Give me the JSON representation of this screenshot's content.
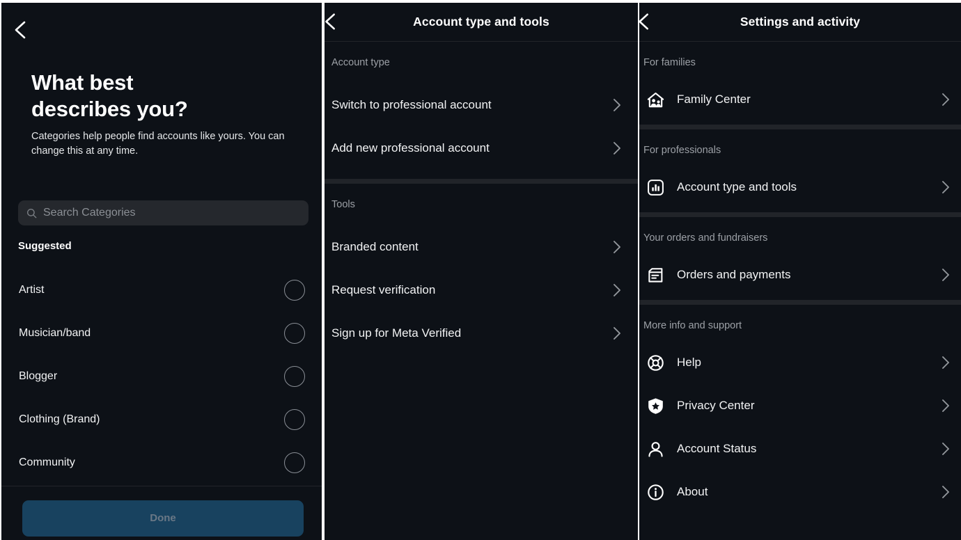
{
  "theme": {
    "background": "#0d1117",
    "page_background": "#ffffff",
    "text_primary": "#f2f3f4",
    "text_secondary": "#9ca0a6",
    "divider": "#212429",
    "search_field_bg": "#25282d",
    "done_button_bg": "#18425f",
    "done_button_text": "#6a7886"
  },
  "panel1": {
    "back_icon": "chevron-left-icon",
    "heading_line1": "What best",
    "heading_line2": "describes you?",
    "subtitle": "Categories help people find accounts like yours. You can change this at any time.",
    "search": {
      "icon": "search-icon",
      "placeholder": "Search Categories",
      "value": ""
    },
    "suggested_label": "Suggested",
    "categories": [
      {
        "label": "Artist",
        "selected": false
      },
      {
        "label": "Musician/band",
        "selected": false
      },
      {
        "label": "Blogger",
        "selected": false
      },
      {
        "label": "Clothing (Brand)",
        "selected": false
      },
      {
        "label": "Community",
        "selected": false
      }
    ],
    "done_label": "Done",
    "done_enabled": false
  },
  "panel2": {
    "back_icon": "chevron-left-icon",
    "title": "Account type and tools",
    "sections": [
      {
        "label": "Account type",
        "items": [
          {
            "label": "Switch to professional account",
            "chevron": "chevron-right-icon"
          },
          {
            "label": "Add new professional account",
            "chevron": "chevron-right-icon"
          }
        ]
      },
      {
        "label": "Tools",
        "items": [
          {
            "label": "Branded content",
            "chevron": "chevron-right-icon"
          },
          {
            "label": "Request verification",
            "chevron": "chevron-right-icon"
          },
          {
            "label": "Sign up for Meta Verified",
            "chevron": "chevron-right-icon"
          }
        ]
      }
    ]
  },
  "panel3": {
    "back_icon": "chevron-left-icon",
    "title": "Settings and activity",
    "sections": [
      {
        "label": "For families",
        "items": [
          {
            "label": "Family Center",
            "icon": "family-center-icon",
            "chevron": "chevron-right-icon"
          }
        ]
      },
      {
        "label": "For professionals",
        "items": [
          {
            "label": "Account type and tools",
            "icon": "bar-chart-icon",
            "chevron": "chevron-right-icon"
          }
        ]
      },
      {
        "label": "Your orders and fundraisers",
        "items": [
          {
            "label": "Orders and payments",
            "icon": "package-box-icon",
            "chevron": "chevron-right-icon"
          }
        ]
      },
      {
        "label": "More info and support",
        "items": [
          {
            "label": "Help",
            "icon": "lifebuoy-icon",
            "chevron": "chevron-right-icon"
          },
          {
            "label": "Privacy Center",
            "icon": "shield-star-icon",
            "chevron": "chevron-right-icon"
          },
          {
            "label": "Account Status",
            "icon": "person-icon",
            "chevron": "chevron-right-icon"
          },
          {
            "label": "About",
            "icon": "info-circle-icon",
            "chevron": "chevron-right-icon"
          }
        ]
      }
    ]
  }
}
